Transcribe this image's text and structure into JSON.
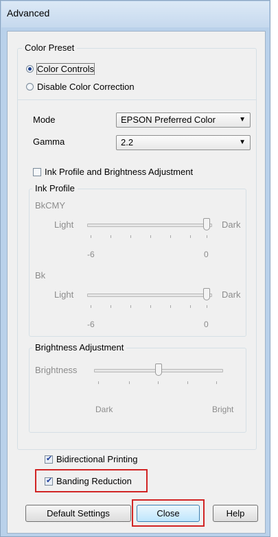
{
  "window": {
    "title": "Advanced"
  },
  "color_preset": {
    "title": "Color Preset",
    "option_color_controls": "Color Controls",
    "option_disable_correction": "Disable Color Correction",
    "selected": "Color Controls"
  },
  "mode": {
    "label": "Mode",
    "value": "EPSON Preferred Color"
  },
  "gamma": {
    "label": "Gamma",
    "value": "2.2"
  },
  "ink_brightness_checkbox": {
    "label": "Ink Profile and Brightness Adjustment",
    "checked": false
  },
  "ink_profile": {
    "title": "Ink Profile",
    "bkcmy": {
      "label": "BkCMY",
      "left": "Light",
      "right": "Dark",
      "min": "-6",
      "max": "0",
      "value": 0
    },
    "bk": {
      "label": "Bk",
      "left": "Light",
      "right": "Dark",
      "min": "-6",
      "max": "0",
      "value": 0
    }
  },
  "brightness": {
    "title": "Brightness Adjustment",
    "label": "Brightness",
    "left": "Dark",
    "right": "Bright",
    "value_fraction": 0.5
  },
  "bidirectional_printing": {
    "label": "Bidirectional Printing",
    "checked": true
  },
  "banding_reduction": {
    "label": "Banding Reduction",
    "checked": true
  },
  "buttons": {
    "default_settings": "Default Settings",
    "close": "Close",
    "help": "Help"
  },
  "colors": {
    "highlight": "#d12424",
    "dialog_bg": "#f0f0f0",
    "frame": "#b9d1ea"
  }
}
